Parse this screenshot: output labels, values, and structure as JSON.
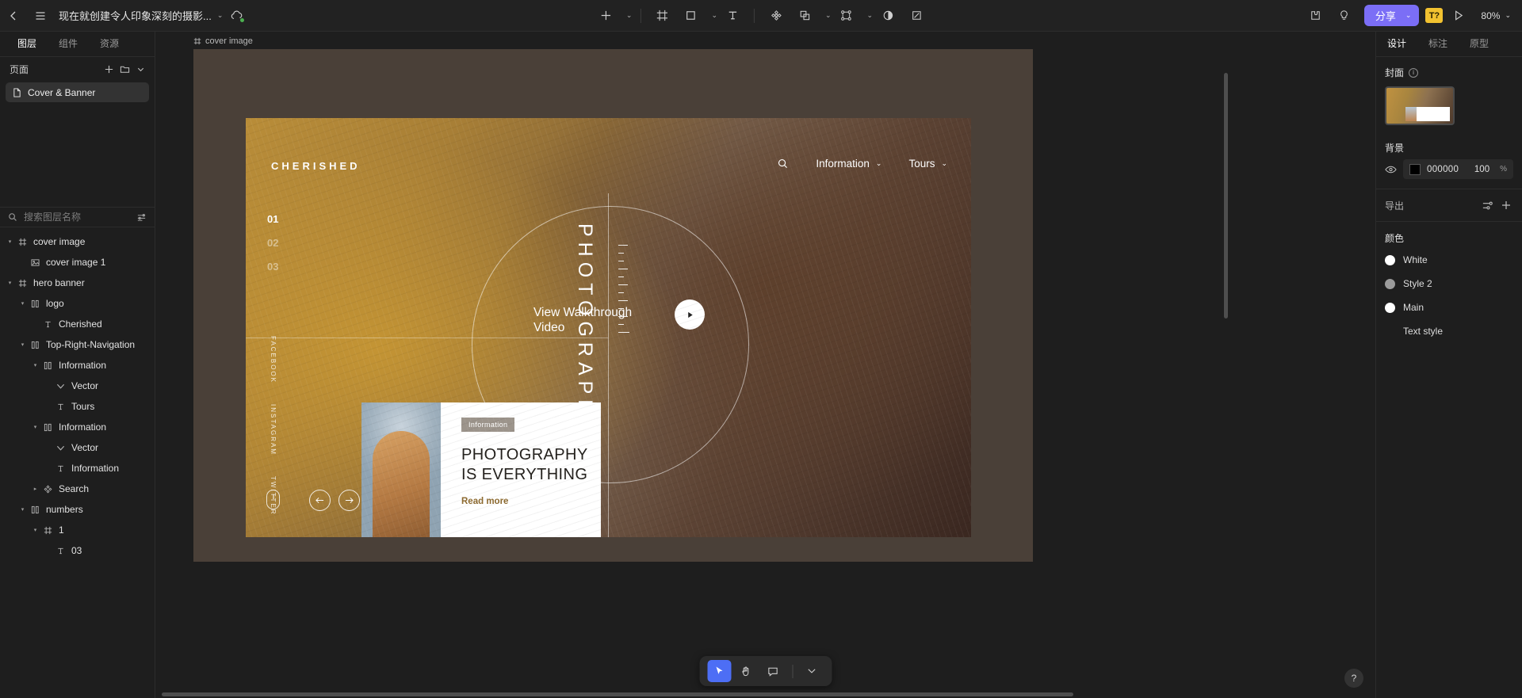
{
  "topbar": {
    "back_icon": "chevron-left-icon",
    "menu_icon": "hamburger-menu-icon",
    "doc_title": "现在就创建令人印象深刻的摄影...",
    "title_caret": "⌄",
    "cloud_icon": "cloud-sync-icon",
    "tools": [
      {
        "name": "add-tool",
        "glyph": "+",
        "caret": true
      },
      {
        "name": "frame-tool",
        "glyph": "frame",
        "caret": false
      },
      {
        "name": "shape-tool",
        "glyph": "square",
        "caret": true
      },
      {
        "name": "text-tool",
        "glyph": "T",
        "caret": false
      },
      {
        "name": "component-tool",
        "glyph": "component",
        "caret": false
      },
      {
        "name": "boolean-tool",
        "glyph": "boolean",
        "caret": true
      },
      {
        "name": "mask-tool",
        "glyph": "mask",
        "caret": true
      },
      {
        "name": "contrast-tool",
        "glyph": "contrast",
        "caret": false
      },
      {
        "name": "crop-tool",
        "glyph": "crop",
        "caret": false
      }
    ],
    "plugin_icon": "plugin-icon",
    "idea_icon": "lightbulb-icon",
    "share_label": "分享",
    "share_caret": "⌄",
    "share_color": "#7b6ef6",
    "tq_badge": "T?",
    "play_icon": "play-icon",
    "zoom_level": "80%",
    "zoom_caret": "⌄"
  },
  "left_panel": {
    "tabs": [
      {
        "label": "图层",
        "active": true
      },
      {
        "label": "组件",
        "active": false
      },
      {
        "label": "资源",
        "active": false
      }
    ],
    "pages_label": "页面",
    "pages_actions": [
      "plus-icon",
      "new-folder-icon",
      "chevron-down-icon"
    ],
    "pages": [
      {
        "label": "Cover & Banner",
        "icon": "page-icon",
        "selected": true
      }
    ],
    "search_placeholder": "搜索图层名称",
    "search_value": "",
    "search_icon": "search-icon",
    "filter_icon": "filter-icon",
    "layers": [
      {
        "label": "cover image",
        "indent": 0,
        "arrow": "▾",
        "icon": "frame"
      },
      {
        "label": "cover image 1",
        "indent": 1,
        "arrow": "",
        "icon": "image"
      },
      {
        "label": "hero banner",
        "indent": 0,
        "arrow": "▾",
        "icon": "frame"
      },
      {
        "label": "logo",
        "indent": 1,
        "arrow": "▾",
        "icon": "group"
      },
      {
        "label": "Cherished",
        "indent": 2,
        "arrow": "",
        "icon": "text"
      },
      {
        "label": "Top-Right-Navigation",
        "indent": 1,
        "arrow": "▾",
        "icon": "group"
      },
      {
        "label": "Information",
        "indent": 2,
        "arrow": "▾",
        "icon": "group"
      },
      {
        "label": "Vector",
        "indent": 3,
        "arrow": "",
        "icon": "vector"
      },
      {
        "label": "Tours",
        "indent": 3,
        "arrow": "",
        "icon": "text"
      },
      {
        "label": "Information",
        "indent": 2,
        "arrow": "▾",
        "icon": "group"
      },
      {
        "label": "Vector",
        "indent": 3,
        "arrow": "",
        "icon": "vector"
      },
      {
        "label": "Information",
        "indent": 3,
        "arrow": "",
        "icon": "text"
      },
      {
        "label": "Search",
        "indent": 2,
        "arrow": "▸",
        "icon": "component"
      },
      {
        "label": "numbers",
        "indent": 1,
        "arrow": "▾",
        "icon": "group"
      },
      {
        "label": "1",
        "indent": 2,
        "arrow": "▾",
        "icon": "frame"
      },
      {
        "label": "03",
        "indent": 3,
        "arrow": "",
        "icon": "text"
      }
    ]
  },
  "canvas": {
    "frame_label": "cover image",
    "frame_icon": "frame-icon",
    "hero": {
      "logo": "CHERISHED",
      "search_icon": "search-icon",
      "nav": [
        {
          "label": "Information",
          "caret": "⌄"
        },
        {
          "label": "Tours",
          "caret": "⌄"
        }
      ],
      "numbers": [
        {
          "value": "01",
          "active": true
        },
        {
          "value": "02",
          "active": false
        },
        {
          "value": "03",
          "active": false
        }
      ],
      "socials": [
        "FACEBOOK",
        "INSTAGRAM",
        "TWITTER"
      ],
      "vertical_title": "PHOTOGRAPHY",
      "walkthrough_line1": "View Walkthrough",
      "walkthrough_line2": "Video",
      "play_icon": "play-icon",
      "prev_icon": "arrow-left-icon",
      "next_icon": "arrow-right-icon",
      "card": {
        "badge": "Information",
        "title_line1": "PHOTOGRAPHY",
        "title_line2": "IS EVERYTHING",
        "link": "Read more",
        "link_color": "#8d6a2f"
      }
    },
    "floating_toolbar": [
      {
        "name": "move-tool",
        "glyph": "➤",
        "active": true
      },
      {
        "name": "hand-tool",
        "glyph": "✋",
        "active": false
      },
      {
        "name": "comment-tool",
        "glyph": "💬",
        "active": false
      },
      {
        "name": "more-tool",
        "glyph": "⌄",
        "active": false
      }
    ],
    "help_label": "?"
  },
  "right_panel": {
    "tabs": [
      {
        "label": "设计",
        "active": true
      },
      {
        "label": "标注",
        "active": false
      },
      {
        "label": "原型",
        "active": false
      }
    ],
    "cover_label": "封面",
    "cover_info_icon": "info-icon",
    "background_label": "背景",
    "background_hex": "000000",
    "background_opacity": "100",
    "background_pct": "%",
    "eye_icon": "eye-icon",
    "export_label": "导出",
    "export_settings_icon": "settings-sliders-icon",
    "export_add_icon": "plus-icon",
    "color_label": "颜色",
    "colors": [
      {
        "label": "White",
        "hex": "#ffffff"
      },
      {
        "label": "Style 2",
        "hex": "#9b9b9b"
      },
      {
        "label": "Main",
        "hex": "#ffffff"
      }
    ],
    "text_style_label": "Text style"
  }
}
